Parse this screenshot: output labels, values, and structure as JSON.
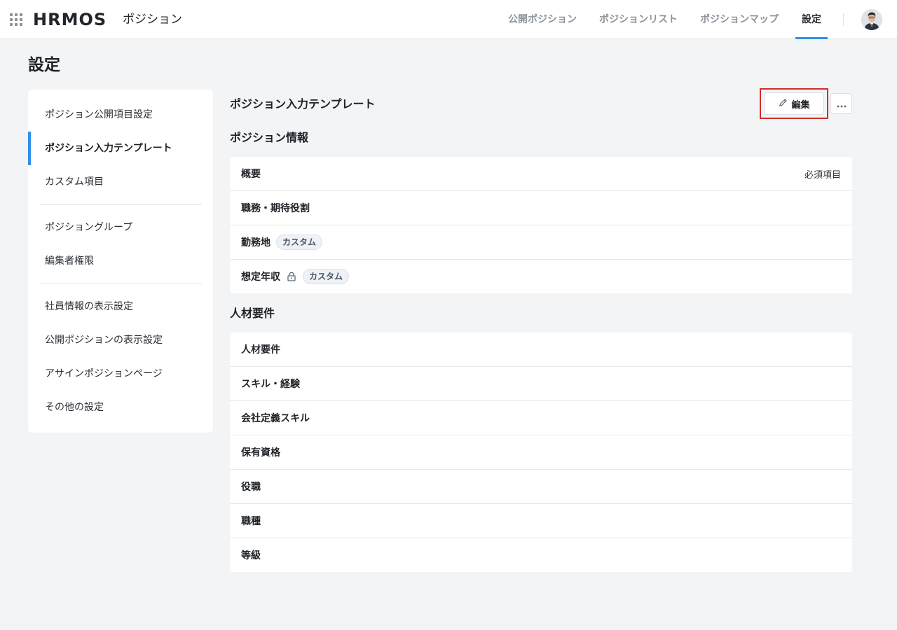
{
  "header": {
    "logo": "HRMOS",
    "product": "ポジション",
    "tabs": [
      {
        "label": "公開ポジション",
        "active": false
      },
      {
        "label": "ポジションリスト",
        "active": false
      },
      {
        "label": "ポジションマップ",
        "active": false
      },
      {
        "label": "設定",
        "active": true
      }
    ]
  },
  "page": {
    "title": "設定"
  },
  "sidebar": {
    "groups": [
      [
        "ポジション公開項目設定",
        "ポジション入力テンプレート",
        "カスタム項目"
      ],
      [
        "ポジショングループ",
        "編集者権限"
      ],
      [
        "社員情報の表示設定",
        "公開ポジションの表示設定",
        "アサインポジションページ",
        "その他の設定"
      ]
    ],
    "active_item": "ポジション入力テンプレート"
  },
  "main": {
    "title": "ポジション入力テンプレート",
    "edit_label": "編集",
    "sections": [
      {
        "title": "ポジション情報",
        "rows": [
          {
            "label": "概要",
            "right": "必須項目"
          },
          {
            "label": "職務・期待役割"
          },
          {
            "label": "勤務地",
            "badge": "カスタム"
          },
          {
            "label": "想定年収",
            "lock": true,
            "badge": "カスタム"
          }
        ]
      },
      {
        "title": "人材要件",
        "rows": [
          {
            "label": "人材要件"
          },
          {
            "label": "スキル・経験"
          },
          {
            "label": "会社定義スキル"
          },
          {
            "label": "保有資格"
          },
          {
            "label": "役職"
          },
          {
            "label": "職種"
          },
          {
            "label": "等級"
          }
        ]
      }
    ]
  },
  "colors": {
    "accent": "#2f8fe6",
    "highlight": "#d12c2c",
    "background": "#f3f4f6"
  }
}
